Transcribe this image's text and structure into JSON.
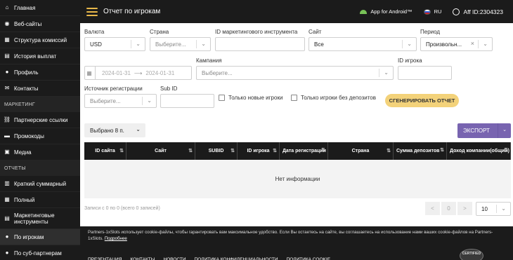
{
  "sidebar": {
    "items": [
      {
        "label": "Главная",
        "icon": "home-icon",
        "glyph": "⌂"
      },
      {
        "label": "Веб-сайты",
        "icon": "globe-icon",
        "glyph": "◉"
      },
      {
        "label": "Структура комиссий",
        "icon": "structure-icon",
        "glyph": "▦"
      },
      {
        "label": "История выплат",
        "icon": "history-icon",
        "glyph": "▤"
      },
      {
        "label": "Профиль",
        "icon": "user-icon",
        "glyph": "●"
      },
      {
        "label": "Контакты",
        "icon": "mail-icon",
        "glyph": "✉"
      }
    ],
    "section_marketing": "МАРКЕТИНГ",
    "marketing_items": [
      {
        "label": "Партнерские ссылки",
        "icon": "link-icon",
        "glyph": "⛓"
      },
      {
        "label": "Промокоды",
        "icon": "promo-icon",
        "glyph": "▬"
      },
      {
        "label": "Медиа",
        "icon": "media-icon",
        "glyph": "▣"
      }
    ],
    "section_reports": "ОТЧЕТЫ",
    "report_items": [
      {
        "label": "Краткий суммарный",
        "icon": "chart-icon",
        "glyph": "▥"
      },
      {
        "label": "Полный",
        "icon": "table-icon",
        "glyph": "▦"
      },
      {
        "label": "Маркетинговые инструменты",
        "icon": "tools-icon",
        "glyph": "▤"
      },
      {
        "label": "По игрокам",
        "icon": "players-icon",
        "glyph": "●"
      },
      {
        "label": "По суб-партнерам",
        "icon": "subpartners-icon",
        "glyph": "●"
      }
    ]
  },
  "header": {
    "title": "Отчет по игрокам",
    "android": "App for Android™",
    "lang": "RU",
    "aff": "Aff ID:2304323"
  },
  "filters": {
    "currency_label": "Валюта",
    "currency_value": "USD",
    "country_label": "Страна",
    "country_placeholder": "Выберите...",
    "tool_id_label": "ID маркетингового инструмента",
    "site_label": "Сайт",
    "site_value": "Все",
    "period_label": "Период",
    "period_value": "Произвольн...",
    "date_from": "2024-01-31",
    "date_to": "2024-01-31",
    "campaign_label": "Кампания",
    "campaign_placeholder": "Выберите...",
    "player_id_label": "ID игрока",
    "reg_source_label": "Источник регистрации",
    "reg_source_placeholder": "Выберите...",
    "sub_id_label": "Sub ID",
    "only_new_label": "Только новые игроки",
    "no_deposit_label": "Только игроки без депозитов",
    "generate_button": "СГЕНЕРИРОВАТЬ ОТЧЕТ"
  },
  "table": {
    "selected_label": "Выбрано 8 п.",
    "export_label": "ЭКСПОРТ",
    "columns": [
      "ID сайта",
      "Сайт",
      "SUBID",
      "ID игрока",
      "Дата регистрации",
      "Страна",
      "Сумма депозитов",
      "Доход компании(общий)"
    ],
    "empty_text": "Нет информации",
    "info": "Записи с 0 по 0 (всего 0 записей)",
    "page_prev": "<",
    "page_current": "0",
    "page_next": ">",
    "per_page": "10"
  },
  "cookie": {
    "text": "Partners-1xSlots использует cookie-файлы, чтобы гарантировать вам максимальное удобство. Если Вы остаетесь на сайте, вы соглашаетесь на использование нами ваших cookie-файлов на Partners-1xSlots.",
    "more": "Подробнее"
  },
  "footer": {
    "links": [
      "ПРЕЗЕНТАЦИЯ",
      "КОНТАКТЫ",
      "НОВОСТИ",
      "ПОЛИТИКА КОНФИДЕНЦИАЛЬНОСТИ",
      "ПОЛИТИКА COOKIE"
    ],
    "badge": "CERTIFIED"
  }
}
